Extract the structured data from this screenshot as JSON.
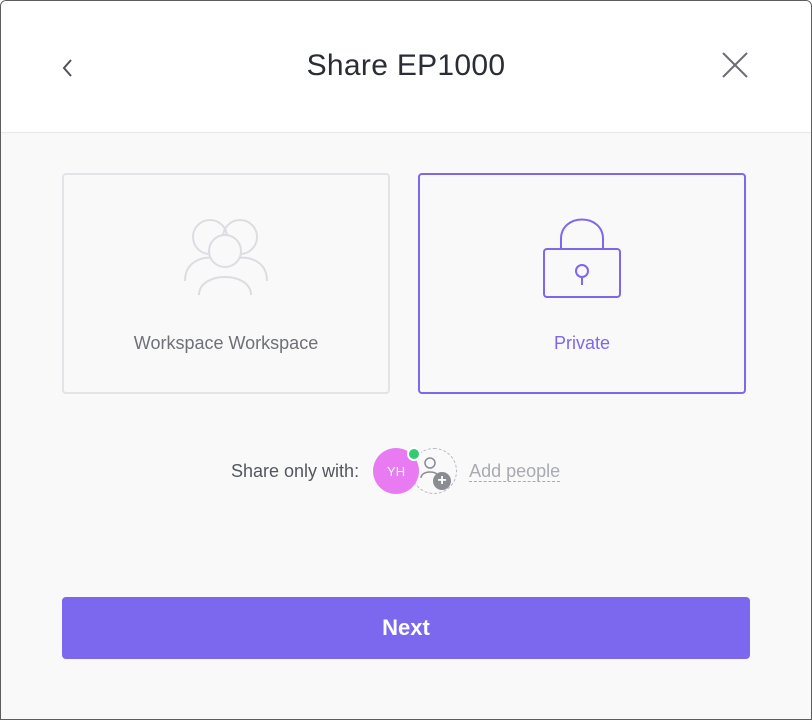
{
  "header": {
    "title": "Share EP1000"
  },
  "options": [
    {
      "label": "Workspace Workspace",
      "icon": "users-icon",
      "selected": false
    },
    {
      "label": "Private",
      "icon": "lock-icon",
      "selected": true
    }
  ],
  "share": {
    "label": "Share only with:",
    "avatar_initials": "YH",
    "add_people_label": "Add people"
  },
  "next_label": "Next",
  "colors": {
    "accent": "#7b68ee",
    "avatar": "#e87bf2",
    "online": "#2ecd6f"
  }
}
